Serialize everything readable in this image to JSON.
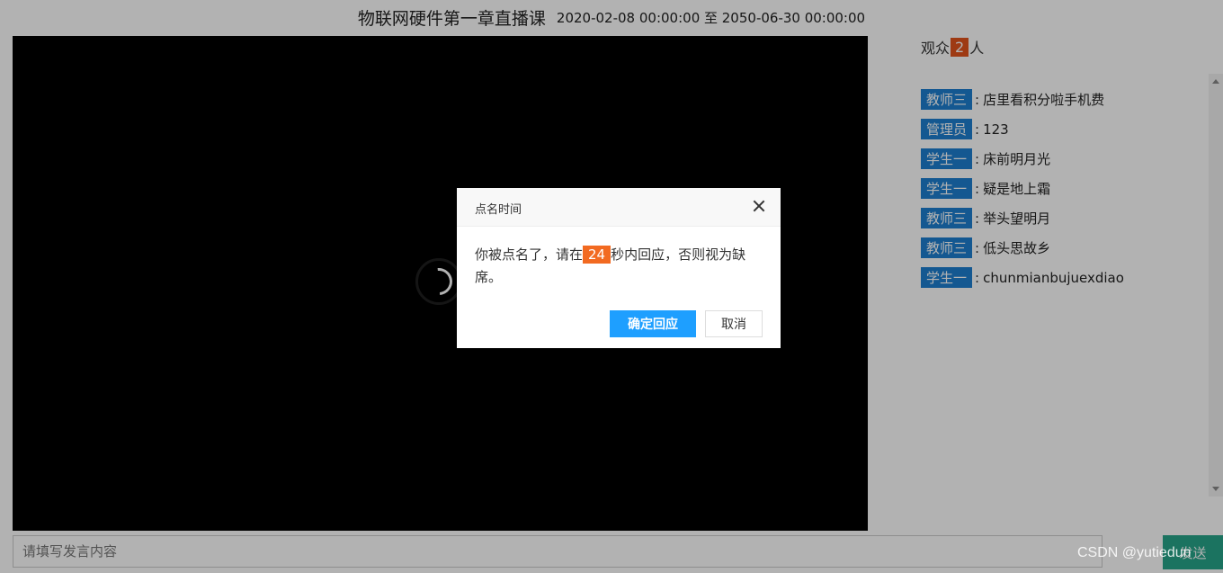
{
  "header": {
    "title": "物联网硬件第一章直播课",
    "time_range": "2020-02-08 00:00:00 至 2050-06-30 00:00:00"
  },
  "audience": {
    "prefix": "观众",
    "count": "2",
    "suffix": "人"
  },
  "chat": {
    "messages": [
      {
        "role": "教师三",
        "text": "店里看积分啦手机费"
      },
      {
        "role": "管理员",
        "text": "123"
      },
      {
        "role": "学生一",
        "text": "床前明月光"
      },
      {
        "role": "学生一",
        "text": "疑是地上霜"
      },
      {
        "role": "教师三",
        "text": "举头望明月"
      },
      {
        "role": "教师三",
        "text": "低头思故乡"
      },
      {
        "role": "学生一",
        "text": "chunmianbujuexdiao"
      }
    ],
    "input_placeholder": "请填写发言内容",
    "send_label": "发送"
  },
  "dialog": {
    "title": "点名时间",
    "text_before": "你被点名了，请在",
    "seconds": "24",
    "text_after": "秒内回应，否则视为缺席。",
    "confirm_label": "确定回应",
    "cancel_label": "取消"
  },
  "watermark": "CSDN @yutiedun",
  "colors": {
    "role_badge": "#1e7fd0",
    "count_badge": "#e2531c",
    "confirm_button": "#1e9fff",
    "send_button": "#27a58a"
  },
  "icons": [
    "loading-spinner-icon",
    "close-icon",
    "scroll-up-arrow-icon",
    "scroll-down-arrow-icon"
  ]
}
